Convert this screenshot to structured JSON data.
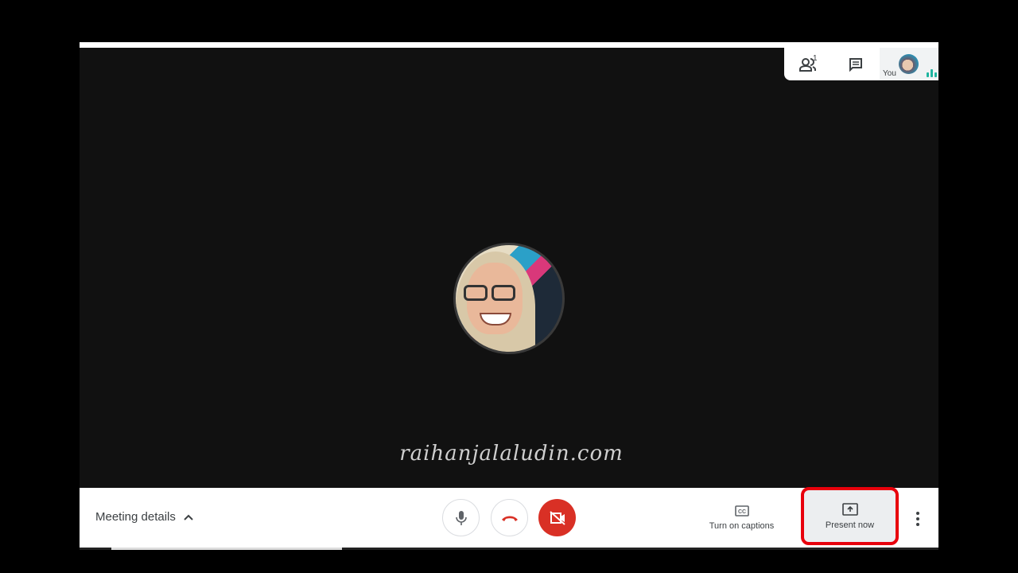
{
  "top_panel": {
    "participants_count": "1",
    "you_label": "You",
    "icons": [
      "people-icon",
      "chat-icon"
    ]
  },
  "watermark": "raihanjalaludin.com",
  "bottom_bar": {
    "meeting_details": "Meeting details",
    "captions_label": "Turn on captions",
    "present_label": "Present now",
    "highlight_color": "#e8000c",
    "end_call_color": "#d93025"
  }
}
